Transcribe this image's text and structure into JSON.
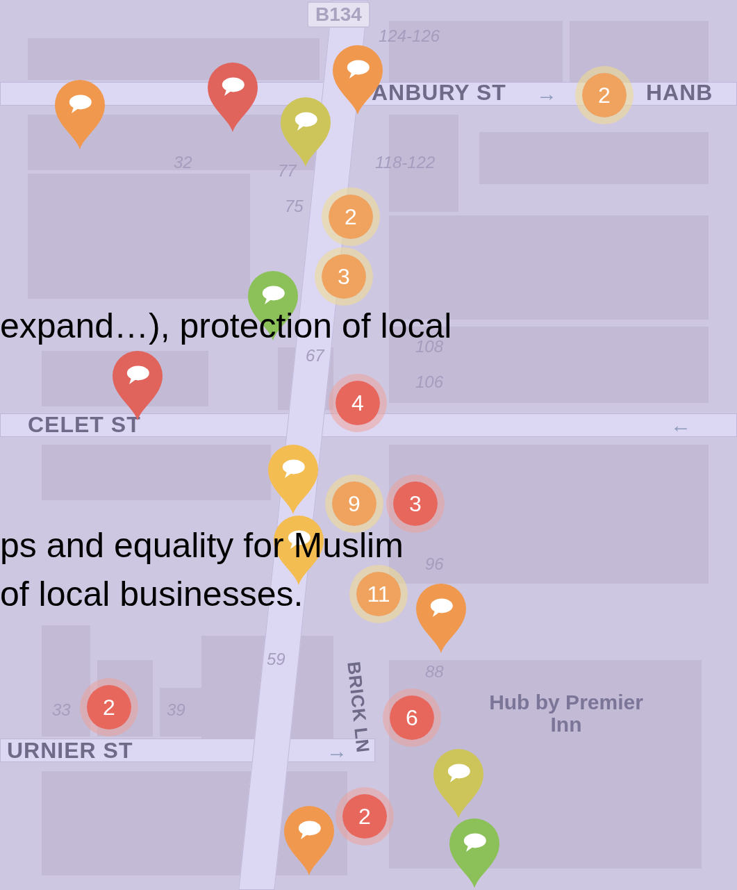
{
  "map": {
    "road_shield": "B134",
    "street_labels": [
      {
        "text": "ANBURY ST",
        "kind": "horizontal"
      },
      {
        "text": "HANB",
        "kind": "horizontal"
      },
      {
        "text": "CELET ST",
        "kind": "horizontal"
      },
      {
        "text": "URNIER ST",
        "kind": "horizontal"
      },
      {
        "text": "BRICK LN",
        "kind": "vertical"
      }
    ],
    "direction_arrows": [
      "→",
      "←",
      "→"
    ],
    "house_numbers": [
      "124-126",
      "32",
      "77",
      "75",
      "118-122",
      "67",
      "108",
      "106",
      "96",
      "59",
      "39",
      "33",
      "88"
    ],
    "place_label": "Hub by Premier Inn",
    "markers": [
      {
        "kind": "pin",
        "color": "#f0994e"
      },
      {
        "kind": "pin",
        "color": "#e0645c"
      },
      {
        "kind": "pin",
        "color": "#cdc45a"
      },
      {
        "kind": "pin",
        "color": "#f0994e"
      },
      {
        "kind": "cluster",
        "count": "2",
        "color": "#f0a35e"
      },
      {
        "kind": "cluster",
        "count": "2",
        "color": "#f0a35e"
      },
      {
        "kind": "pin",
        "color": "#8cc15a"
      },
      {
        "kind": "cluster",
        "count": "3",
        "color": "#f0a35e"
      },
      {
        "kind": "pin",
        "color": "#e0645c"
      },
      {
        "kind": "cluster",
        "count": "4",
        "color": "#e8675d"
      },
      {
        "kind": "pin",
        "color": "#f3bd52"
      },
      {
        "kind": "pin",
        "color": "#f3bd52"
      },
      {
        "kind": "cluster",
        "count": "9",
        "color": "#f0a35e"
      },
      {
        "kind": "cluster",
        "count": "3",
        "color": "#e8675d"
      },
      {
        "kind": "cluster",
        "count": "11",
        "color": "#f0a35e"
      },
      {
        "kind": "pin",
        "color": "#f0994e"
      },
      {
        "kind": "cluster",
        "count": "2",
        "color": "#e8675d"
      },
      {
        "kind": "cluster",
        "count": "6",
        "color": "#e8675d"
      },
      {
        "kind": "pin",
        "color": "#cdc45a"
      },
      {
        "kind": "cluster",
        "count": "2",
        "color": "#e8675d"
      },
      {
        "kind": "pin",
        "color": "#f0994e"
      },
      {
        "kind": "pin",
        "color": "#8cc15a"
      }
    ]
  },
  "slide_text": [
    "expand…), protection of local",
    "ps and equality for Muslim",
    "of local businesses."
  ]
}
